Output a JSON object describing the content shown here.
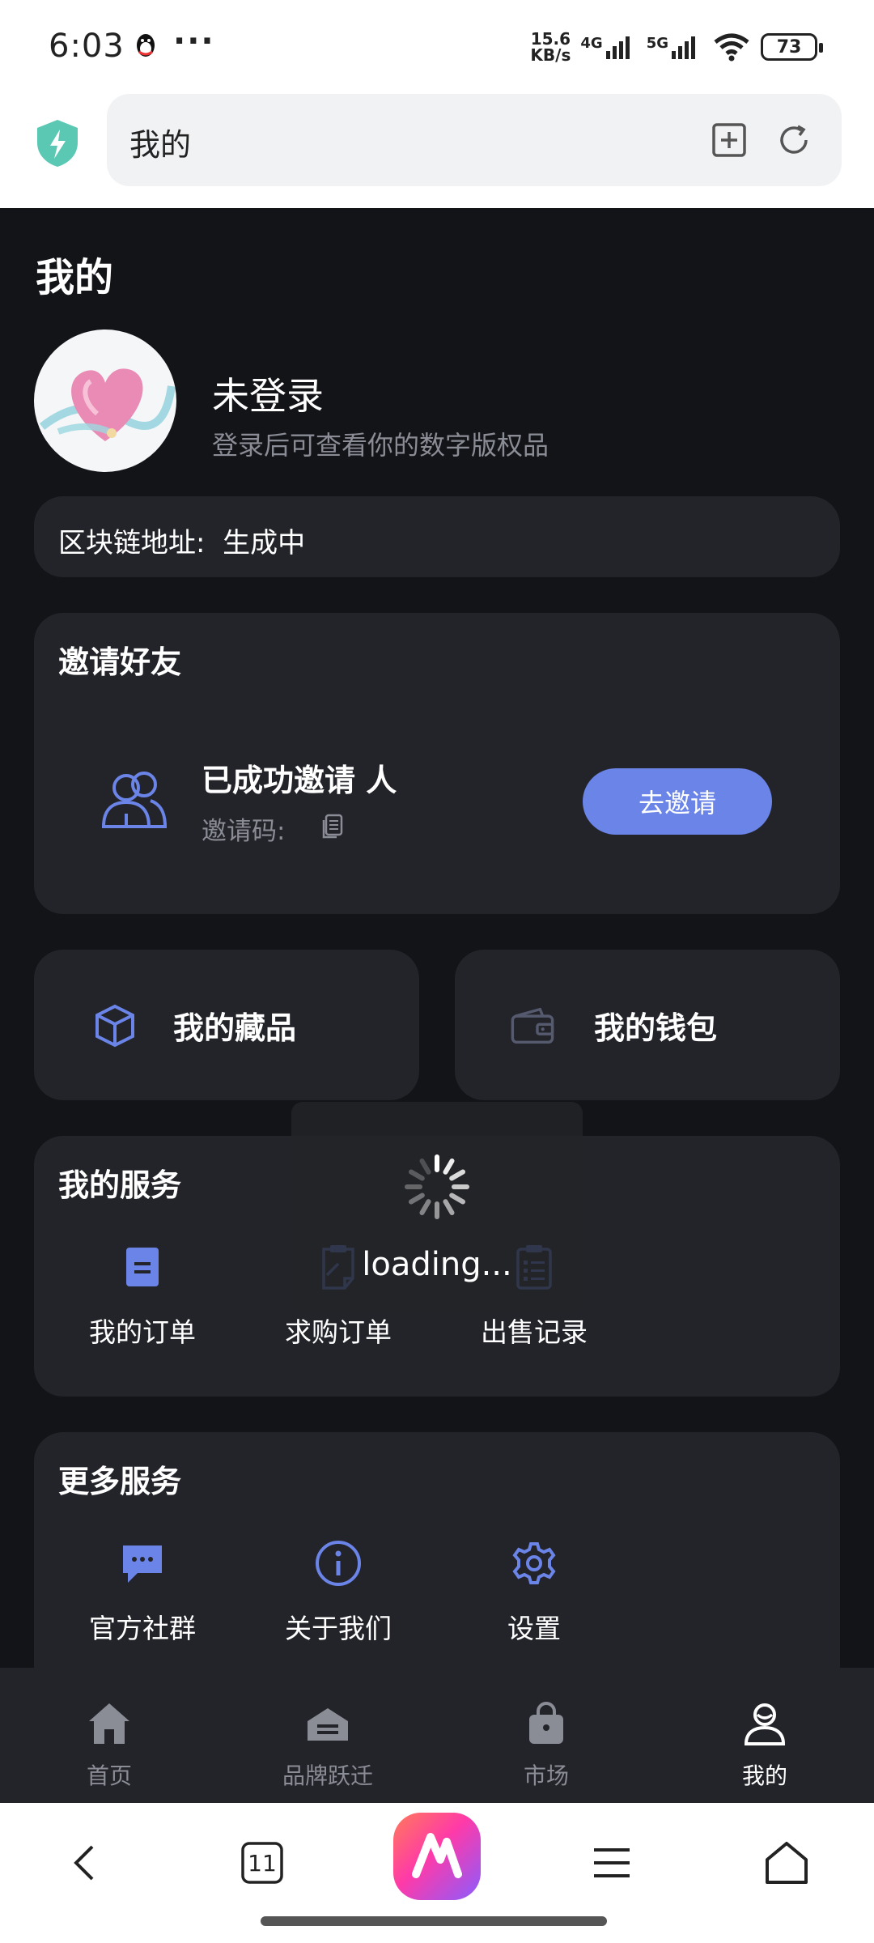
{
  "status_bar": {
    "time": "6:03",
    "more": "···",
    "speed_top": "15.6",
    "speed_bottom": "KB/s",
    "net1": "4G",
    "net2": "5G",
    "battery": "73"
  },
  "browser": {
    "url_text": "我的",
    "tab_count": "11"
  },
  "page": {
    "title": "我的",
    "user": {
      "name": "未登录",
      "subtitle": "登录后可查看你的数字版权品"
    },
    "chain_address_label": "区块链地址:",
    "chain_address_value": "生成中",
    "invite": {
      "title": "邀请好友",
      "count_text": "已成功邀请 人",
      "code_label": "邀请码:",
      "button": "去邀请"
    },
    "collection_label": "我的藏品",
    "wallet_label": "我的钱包",
    "services": {
      "title": "我的服务",
      "items": [
        {
          "label": "我的订单",
          "icon": "order-doc-icon"
        },
        {
          "label": "求购订单",
          "icon": "purchase-clipboard-icon"
        },
        {
          "label": "出售记录",
          "icon": "sales-record-icon"
        }
      ]
    },
    "more_services": {
      "title": "更多服务",
      "items": [
        {
          "label": "官方社群",
          "icon": "chat-bubble-icon"
        },
        {
          "label": "关于我们",
          "icon": "info-icon"
        },
        {
          "label": "设置",
          "icon": "gear-icon"
        }
      ]
    },
    "loading_text": "loading..."
  },
  "tabbar": [
    {
      "label": "首页",
      "icon": "home-icon"
    },
    {
      "label": "品牌跃迁",
      "icon": "brand-icon"
    },
    {
      "label": "市场",
      "icon": "shopping-bag-icon"
    },
    {
      "label": "我的",
      "icon": "profile-icon"
    }
  ],
  "colors": {
    "accent": "#6b84e8",
    "background": "#131418",
    "card": "#23242a"
  }
}
